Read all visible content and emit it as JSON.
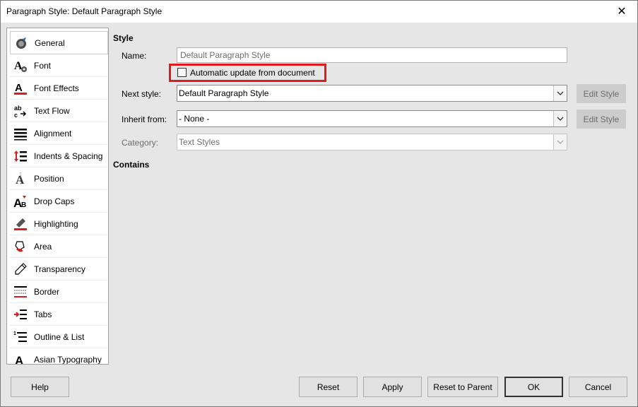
{
  "window": {
    "title": "Paragraph Style: Default Paragraph Style",
    "close_glyph": "✕"
  },
  "sidebar": {
    "items": [
      {
        "label": "General",
        "icon": "general-icon",
        "selected": true
      },
      {
        "label": "Font",
        "icon": "font-icon"
      },
      {
        "label": "Font Effects",
        "icon": "font-effects-icon"
      },
      {
        "label": "Text Flow",
        "icon": "text-flow-icon"
      },
      {
        "label": "Alignment",
        "icon": "alignment-icon"
      },
      {
        "label": "Indents & Spacing",
        "icon": "indents-spacing-icon"
      },
      {
        "label": "Position",
        "icon": "position-icon"
      },
      {
        "label": "Drop Caps",
        "icon": "drop-caps-icon"
      },
      {
        "label": "Highlighting",
        "icon": "highlighting-icon"
      },
      {
        "label": "Area",
        "icon": "area-icon"
      },
      {
        "label": "Transparency",
        "icon": "transparency-icon"
      },
      {
        "label": "Border",
        "icon": "border-icon"
      },
      {
        "label": "Tabs",
        "icon": "tabs-icon"
      },
      {
        "label": "Outline & List",
        "icon": "outline-list-icon"
      },
      {
        "label": "Asian Typography",
        "icon": "asian-typography-icon"
      }
    ]
  },
  "style_section": {
    "heading": "Style",
    "name_label": "Name:",
    "name_value": "Default Paragraph Style",
    "auto_update_label": "Automatic update from document",
    "auto_update_checked": false,
    "next_style_label": "Next style:",
    "next_style_value": "Default Paragraph Style",
    "inherit_label": "Inherit from:",
    "inherit_value": "- None -",
    "category_label": "Category:",
    "category_value": "Text Styles",
    "edit_style_label": "Edit Style"
  },
  "contains_section": {
    "heading": "Contains"
  },
  "buttons": {
    "help": "Help",
    "reset": "Reset",
    "apply": "Apply",
    "reset_to_parent": "Reset to Parent",
    "ok": "OK",
    "cancel": "Cancel"
  },
  "colors": {
    "highlight_box": "#e01b1b",
    "background": "#e6e6e6"
  }
}
